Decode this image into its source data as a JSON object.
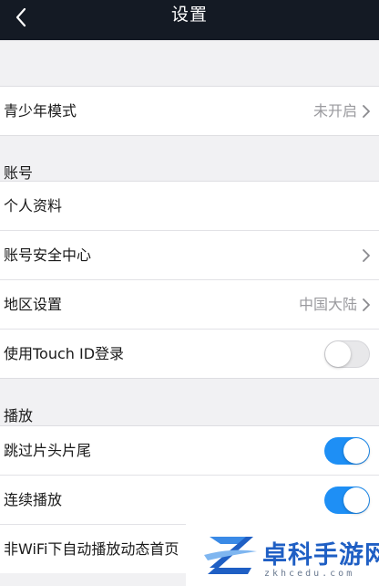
{
  "header": {
    "title": "设置",
    "back_icon": "chevron-left-icon"
  },
  "teen_mode": {
    "label": "青少年模式",
    "value": "未开启"
  },
  "account": {
    "section_title": "账号",
    "items": [
      {
        "label": "个人资料"
      },
      {
        "label": "账号安全中心"
      },
      {
        "label": "地区设置",
        "value": "中国大陆"
      },
      {
        "label": "使用Touch ID登录",
        "toggle": "off"
      }
    ]
  },
  "playback": {
    "section_title": "播放",
    "items": [
      {
        "label": "跳过片头片尾",
        "toggle": "on"
      },
      {
        "label": "连续播放",
        "toggle": "on"
      },
      {
        "label": "非WiFi下自动播放动态首页"
      }
    ]
  },
  "watermark": {
    "name": "卓科手游网",
    "url": "zkhcedu.com"
  },
  "colors": {
    "header_bg": "#141a24",
    "toggle_on": "#1e8ff5",
    "page_bg": "#f1f1f3",
    "watermark_blue": "#1f5fc4"
  }
}
